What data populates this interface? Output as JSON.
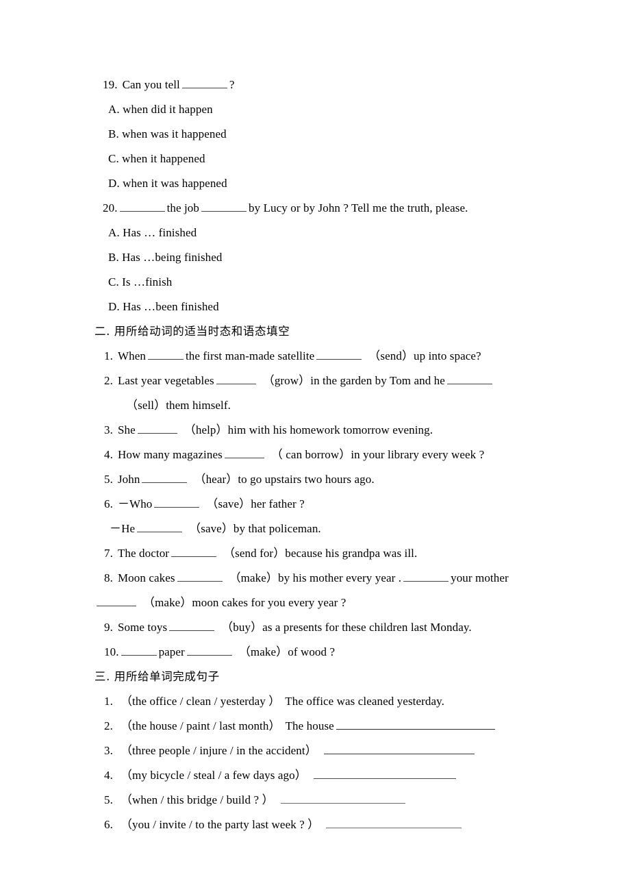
{
  "document": {
    "type": "english-grammar-worksheet",
    "text_color": "#000000",
    "background_color": "#ffffff"
  },
  "section_one_tail": {
    "questions": [
      {
        "number": "19.",
        "stem_before": "Can you tell",
        "stem_after": "?",
        "options": [
          "A. when did it happen",
          "B. when was it happened",
          "C. when it happened",
          "D. when it was happened"
        ]
      },
      {
        "number": "20.",
        "stem_part1": "the job",
        "stem_part2": "by Lucy or by John ? Tell me the truth, please.",
        "options": [
          "A. Has … finished",
          "B. Has …being finished",
          "C. Is …finish",
          "D. Has …been finished"
        ]
      }
    ]
  },
  "section_two": {
    "heading": "二. 用所给动词的适当时态和语态填空",
    "items": [
      {
        "number": "1.",
        "parts": [
          "When",
          "the first man-made satellite",
          "（send）up into space?"
        ]
      },
      {
        "number": "2.",
        "parts": [
          "Last year vegetables",
          "（grow）in the garden by Tom and he",
          ""
        ],
        "continuation": "（sell）them himself."
      },
      {
        "number": "3.",
        "parts": [
          "She",
          "（help）him with his homework tomorrow evening."
        ]
      },
      {
        "number": "4.",
        "parts": [
          "How many magazines",
          "（ can borrow）in your library every week ?"
        ]
      },
      {
        "number": "5.",
        "parts": [
          "John",
          "（hear）to go upstairs two hours ago."
        ]
      },
      {
        "number": "6.",
        "parts": [
          "－Who",
          "（save）her father ?"
        ],
        "reply_before": "－He",
        "reply_after": "（save）by that policeman."
      },
      {
        "number": "7.",
        "parts": [
          "The doctor",
          "（send for）because his grandpa was ill."
        ]
      },
      {
        "number": "8.",
        "parts": [
          "Moon cakes",
          "（make）by his mother every year .",
          "your mother"
        ],
        "continuation": "（make）moon cakes for you every year ?"
      },
      {
        "number": "9.",
        "parts": [
          "Some toys",
          "（buy）as a presents for these children last Monday."
        ]
      },
      {
        "number": "10.",
        "parts": [
          "",
          "paper",
          "（make）of wood ?"
        ]
      }
    ]
  },
  "section_three": {
    "heading": "三. 用所给单词完成句子",
    "items": [
      {
        "number": "1.",
        "prompt": "（the office / clean / yesterday ）",
        "answer": "The office was cleaned yesterday.",
        "has_blank": false
      },
      {
        "number": "2.",
        "prompt": "（the house / paint / last month）",
        "answer": "The house",
        "has_blank": true
      },
      {
        "number": "3.",
        "prompt": "（three people / injure / in the accident）",
        "answer": "",
        "has_blank": true
      },
      {
        "number": "4.",
        "prompt": "（my bicycle / steal / a few days ago）",
        "answer": "",
        "has_blank": true
      },
      {
        "number": "5.",
        "prompt": "（when / this bridge / build ? ）",
        "answer": "",
        "has_blank": true
      },
      {
        "number": "6.",
        "prompt": "（you / invite / to the party last week ? ）",
        "answer": "",
        "has_blank": true
      }
    ]
  }
}
